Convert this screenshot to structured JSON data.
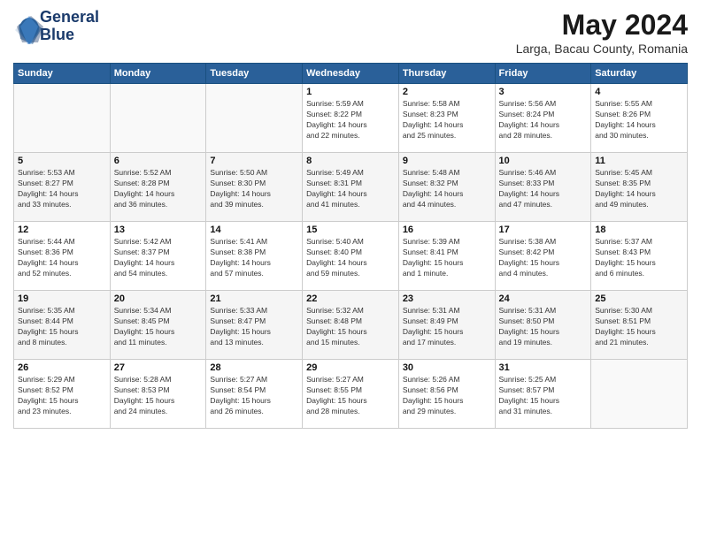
{
  "header": {
    "logo_line1": "General",
    "logo_line2": "Blue",
    "title": "May 2024",
    "location": "Larga, Bacau County, Romania"
  },
  "weekdays": [
    "Sunday",
    "Monday",
    "Tuesday",
    "Wednesday",
    "Thursday",
    "Friday",
    "Saturday"
  ],
  "weeks": [
    [
      {
        "day": "",
        "info": ""
      },
      {
        "day": "",
        "info": ""
      },
      {
        "day": "",
        "info": ""
      },
      {
        "day": "1",
        "info": "Sunrise: 5:59 AM\nSunset: 8:22 PM\nDaylight: 14 hours\nand 22 minutes."
      },
      {
        "day": "2",
        "info": "Sunrise: 5:58 AM\nSunset: 8:23 PM\nDaylight: 14 hours\nand 25 minutes."
      },
      {
        "day": "3",
        "info": "Sunrise: 5:56 AM\nSunset: 8:24 PM\nDaylight: 14 hours\nand 28 minutes."
      },
      {
        "day": "4",
        "info": "Sunrise: 5:55 AM\nSunset: 8:26 PM\nDaylight: 14 hours\nand 30 minutes."
      }
    ],
    [
      {
        "day": "5",
        "info": "Sunrise: 5:53 AM\nSunset: 8:27 PM\nDaylight: 14 hours\nand 33 minutes."
      },
      {
        "day": "6",
        "info": "Sunrise: 5:52 AM\nSunset: 8:28 PM\nDaylight: 14 hours\nand 36 minutes."
      },
      {
        "day": "7",
        "info": "Sunrise: 5:50 AM\nSunset: 8:30 PM\nDaylight: 14 hours\nand 39 minutes."
      },
      {
        "day": "8",
        "info": "Sunrise: 5:49 AM\nSunset: 8:31 PM\nDaylight: 14 hours\nand 41 minutes."
      },
      {
        "day": "9",
        "info": "Sunrise: 5:48 AM\nSunset: 8:32 PM\nDaylight: 14 hours\nand 44 minutes."
      },
      {
        "day": "10",
        "info": "Sunrise: 5:46 AM\nSunset: 8:33 PM\nDaylight: 14 hours\nand 47 minutes."
      },
      {
        "day": "11",
        "info": "Sunrise: 5:45 AM\nSunset: 8:35 PM\nDaylight: 14 hours\nand 49 minutes."
      }
    ],
    [
      {
        "day": "12",
        "info": "Sunrise: 5:44 AM\nSunset: 8:36 PM\nDaylight: 14 hours\nand 52 minutes."
      },
      {
        "day": "13",
        "info": "Sunrise: 5:42 AM\nSunset: 8:37 PM\nDaylight: 14 hours\nand 54 minutes."
      },
      {
        "day": "14",
        "info": "Sunrise: 5:41 AM\nSunset: 8:38 PM\nDaylight: 14 hours\nand 57 minutes."
      },
      {
        "day": "15",
        "info": "Sunrise: 5:40 AM\nSunset: 8:40 PM\nDaylight: 14 hours\nand 59 minutes."
      },
      {
        "day": "16",
        "info": "Sunrise: 5:39 AM\nSunset: 8:41 PM\nDaylight: 15 hours\nand 1 minute."
      },
      {
        "day": "17",
        "info": "Sunrise: 5:38 AM\nSunset: 8:42 PM\nDaylight: 15 hours\nand 4 minutes."
      },
      {
        "day": "18",
        "info": "Sunrise: 5:37 AM\nSunset: 8:43 PM\nDaylight: 15 hours\nand 6 minutes."
      }
    ],
    [
      {
        "day": "19",
        "info": "Sunrise: 5:35 AM\nSunset: 8:44 PM\nDaylight: 15 hours\nand 8 minutes."
      },
      {
        "day": "20",
        "info": "Sunrise: 5:34 AM\nSunset: 8:45 PM\nDaylight: 15 hours\nand 11 minutes."
      },
      {
        "day": "21",
        "info": "Sunrise: 5:33 AM\nSunset: 8:47 PM\nDaylight: 15 hours\nand 13 minutes."
      },
      {
        "day": "22",
        "info": "Sunrise: 5:32 AM\nSunset: 8:48 PM\nDaylight: 15 hours\nand 15 minutes."
      },
      {
        "day": "23",
        "info": "Sunrise: 5:31 AM\nSunset: 8:49 PM\nDaylight: 15 hours\nand 17 minutes."
      },
      {
        "day": "24",
        "info": "Sunrise: 5:31 AM\nSunset: 8:50 PM\nDaylight: 15 hours\nand 19 minutes."
      },
      {
        "day": "25",
        "info": "Sunrise: 5:30 AM\nSunset: 8:51 PM\nDaylight: 15 hours\nand 21 minutes."
      }
    ],
    [
      {
        "day": "26",
        "info": "Sunrise: 5:29 AM\nSunset: 8:52 PM\nDaylight: 15 hours\nand 23 minutes."
      },
      {
        "day": "27",
        "info": "Sunrise: 5:28 AM\nSunset: 8:53 PM\nDaylight: 15 hours\nand 24 minutes."
      },
      {
        "day": "28",
        "info": "Sunrise: 5:27 AM\nSunset: 8:54 PM\nDaylight: 15 hours\nand 26 minutes."
      },
      {
        "day": "29",
        "info": "Sunrise: 5:27 AM\nSunset: 8:55 PM\nDaylight: 15 hours\nand 28 minutes."
      },
      {
        "day": "30",
        "info": "Sunrise: 5:26 AM\nSunset: 8:56 PM\nDaylight: 15 hours\nand 29 minutes."
      },
      {
        "day": "31",
        "info": "Sunrise: 5:25 AM\nSunset: 8:57 PM\nDaylight: 15 hours\nand 31 minutes."
      },
      {
        "day": "",
        "info": ""
      }
    ]
  ]
}
